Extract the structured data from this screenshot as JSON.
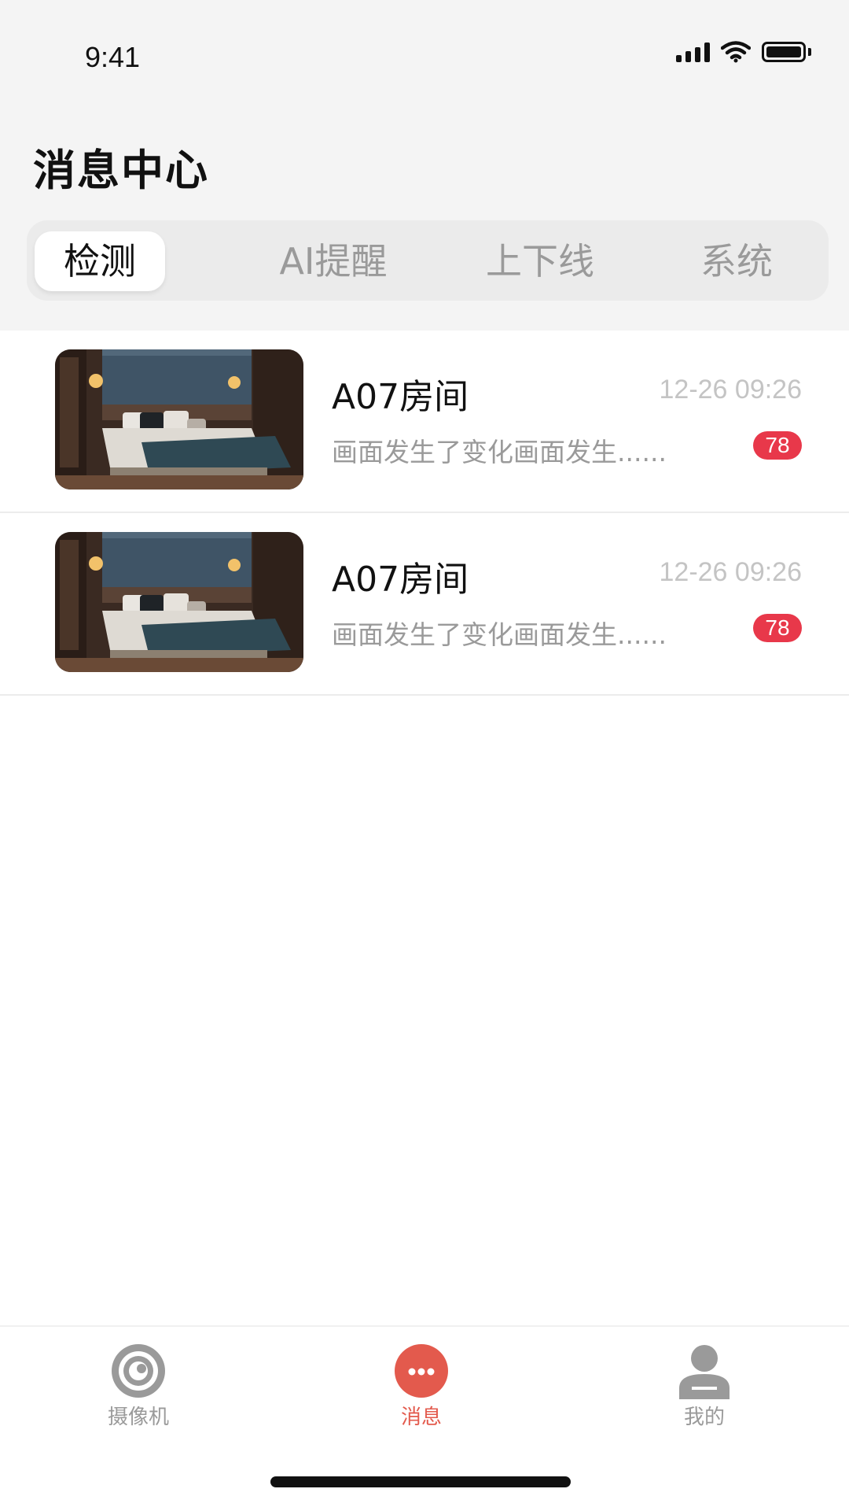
{
  "status_bar": {
    "time": "9:41",
    "icons": [
      "signal-icon",
      "wifi-icon",
      "battery-icon"
    ]
  },
  "header": {
    "title": "消息中心"
  },
  "tabs": [
    {
      "label": "检测",
      "active": true
    },
    {
      "label": "AI提醒",
      "active": false
    },
    {
      "label": "上下线",
      "active": false
    },
    {
      "label": "系统",
      "active": false
    }
  ],
  "messages": [
    {
      "thumbnail": "bedroom-thumbnail",
      "title": "A07房间",
      "time": "12-26 09:26",
      "description": "画面发生了变化画面发生......",
      "badge": "78"
    },
    {
      "thumbnail": "bedroom-thumbnail",
      "title": "A07房间",
      "time": "12-26 09:26",
      "description": "画面发生了变化画面发生......",
      "badge": "78"
    }
  ],
  "bottom_nav": [
    {
      "label": "摄像机",
      "icon": "camera-icon",
      "active": false
    },
    {
      "label": "消息",
      "icon": "message-icon",
      "active": true
    },
    {
      "label": "我的",
      "icon": "user-icon",
      "active": false
    }
  ],
  "colors": {
    "accent": "#e35a4d",
    "badge": "#e8384a",
    "header_bg": "#f4f4f4",
    "muted_text": "#9a9a9a"
  }
}
